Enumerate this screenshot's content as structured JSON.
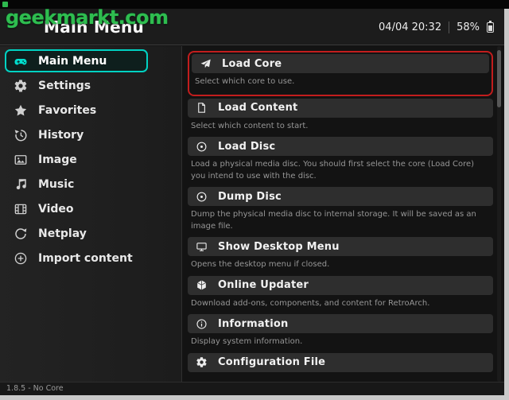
{
  "watermark": {
    "text": "geekmarkt.com"
  },
  "header": {
    "title": "Main Menu",
    "datetime": "04/04 20:32",
    "battery_percent": "58%"
  },
  "sidebar": {
    "items": [
      {
        "label": "Main Menu",
        "icon": "gamepad-icon",
        "active": true
      },
      {
        "label": "Settings",
        "icon": "gear-icon",
        "active": false
      },
      {
        "label": "Favorites",
        "icon": "star-icon",
        "active": false
      },
      {
        "label": "History",
        "icon": "history-icon",
        "active": false
      },
      {
        "label": "Image",
        "icon": "image-icon",
        "active": false
      },
      {
        "label": "Music",
        "icon": "music-note-icon",
        "active": false
      },
      {
        "label": "Video",
        "icon": "film-icon",
        "active": false
      },
      {
        "label": "Netplay",
        "icon": "netplay-refresh-icon",
        "active": false
      },
      {
        "label": "Import content",
        "icon": "plus-circle-icon",
        "active": false
      }
    ]
  },
  "content": {
    "entries": [
      {
        "label": "Load Core",
        "sublabel": "Select which core to use.",
        "icon": "core-icon",
        "highlighted": true
      },
      {
        "label": "Load Content",
        "sublabel": "Select which content to start.",
        "icon": "file-icon",
        "highlighted": false
      },
      {
        "label": "Load Disc",
        "sublabel": "Load a physical media disc. You should first select the core (Load Core)  you intend to use with the disc.",
        "icon": "disc-icon",
        "highlighted": false
      },
      {
        "label": "Dump Disc",
        "sublabel": "Dump the physical media disc to internal storage. It will be saved as an image file.",
        "icon": "disc-icon",
        "highlighted": false
      },
      {
        "label": "Show Desktop Menu",
        "sublabel": "Opens the desktop menu if closed.",
        "icon": "desktop-icon",
        "highlighted": false
      },
      {
        "label": "Online Updater",
        "sublabel": "Download add-ons, components, and content for RetroArch.",
        "icon": "updater-cube-icon",
        "highlighted": false
      },
      {
        "label": "Information",
        "sublabel": "Display system information.",
        "icon": "info-icon",
        "highlighted": false
      },
      {
        "label": "Configuration File",
        "sublabel": "",
        "icon": "gear-icon",
        "highlighted": false
      }
    ]
  },
  "statusbar": {
    "version_text": "1.8.5 - No Core"
  },
  "colors": {
    "accent_teal": "#00d2c2",
    "highlight_red": "#c21d1d",
    "watermark_green": "#2fbd4f",
    "entry_strip": "#2e2e2e",
    "background": "#131313"
  }
}
